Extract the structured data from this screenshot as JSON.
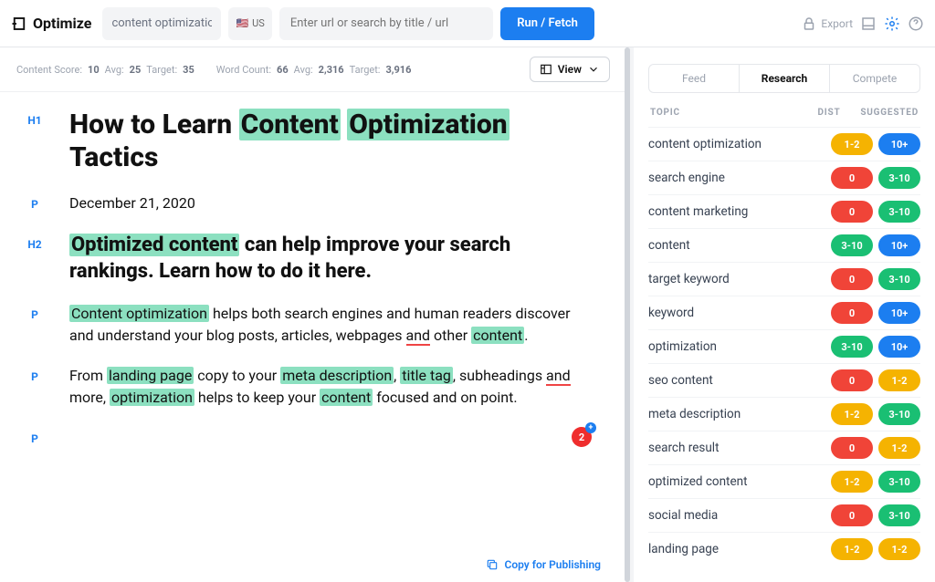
{
  "brand": "Optimize",
  "keyword_input": "content optimization",
  "locale": "US",
  "search_placeholder": "Enter url or search by title / url",
  "run_label": "Run / Fetch",
  "export_label": "Export",
  "stats": {
    "cs_label": "Content Score:",
    "cs": "10",
    "avg_label": "Avg:",
    "avg": "25",
    "target_label": "Target:",
    "target": "35",
    "wc_label": "Word Count:",
    "wc": "66",
    "wc_avg": "2,316",
    "wc_target": "3,916"
  },
  "view_label": "View",
  "editor": {
    "h1_pre": "How to Learn ",
    "h1_hl1": "Content",
    "h1_hl2": "Optimization",
    "h1_post": " Tactics",
    "date": "December 21, 2020",
    "h2_hl": "Optimized content",
    "h2_rest": " can help improve your search rankings. Learn how to do it here.",
    "p1_hl1": "Content optimization",
    "p1_mid": " helps both search engines and human readers discover and understand your blog posts, articles, webpages ",
    "p1_ul": "and",
    "p1_mid2": " other ",
    "p1_hl2": "content",
    "p1_end": ".",
    "p2_a": "From ",
    "p2_hl1": "landing page",
    "p2_b": " copy to your ",
    "p2_hl2": "meta description",
    "p2_c": ", ",
    "p2_hl3": "title tag",
    "p2_d": ", subheadings ",
    "p2_ul": "and",
    "p2_e": " more, ",
    "p2_hl4": "optimization",
    "p2_f": " helps to keep your ",
    "p2_hl5": "content",
    "p2_g": " focused and on point.",
    "notif": "2"
  },
  "copy_label": "Copy for Publishing",
  "tabs": {
    "feed": "Feed",
    "research": "Research",
    "compete": "Compete"
  },
  "cols": {
    "topic": "TOPIC",
    "dist": "DIST",
    "sugg": "SUGGESTED"
  },
  "topics": [
    {
      "name": "content optimization",
      "dist": "1-2",
      "dc": "yellow",
      "sugg": "10+",
      "sc": "blue"
    },
    {
      "name": "search engine",
      "dist": "0",
      "dc": "red",
      "sugg": "3-10",
      "sc": "green"
    },
    {
      "name": "content marketing",
      "dist": "0",
      "dc": "red",
      "sugg": "3-10",
      "sc": "green"
    },
    {
      "name": "content",
      "dist": "3-10",
      "dc": "green",
      "sugg": "10+",
      "sc": "blue"
    },
    {
      "name": "target keyword",
      "dist": "0",
      "dc": "red",
      "sugg": "3-10",
      "sc": "green"
    },
    {
      "name": "keyword",
      "dist": "0",
      "dc": "red",
      "sugg": "10+",
      "sc": "blue"
    },
    {
      "name": "optimization",
      "dist": "3-10",
      "dc": "green",
      "sugg": "10+",
      "sc": "blue"
    },
    {
      "name": "seo content",
      "dist": "0",
      "dc": "red",
      "sugg": "1-2",
      "sc": "yellow"
    },
    {
      "name": "meta description",
      "dist": "1-2",
      "dc": "yellow",
      "sugg": "3-10",
      "sc": "green"
    },
    {
      "name": "search result",
      "dist": "0",
      "dc": "red",
      "sugg": "1-2",
      "sc": "yellow"
    },
    {
      "name": "optimized content",
      "dist": "1-2",
      "dc": "yellow",
      "sugg": "3-10",
      "sc": "green"
    },
    {
      "name": "social media",
      "dist": "0",
      "dc": "red",
      "sugg": "3-10",
      "sc": "green"
    },
    {
      "name": "landing page",
      "dist": "1-2",
      "dc": "yellow",
      "sugg": "1-2",
      "sc": "yellow"
    }
  ]
}
